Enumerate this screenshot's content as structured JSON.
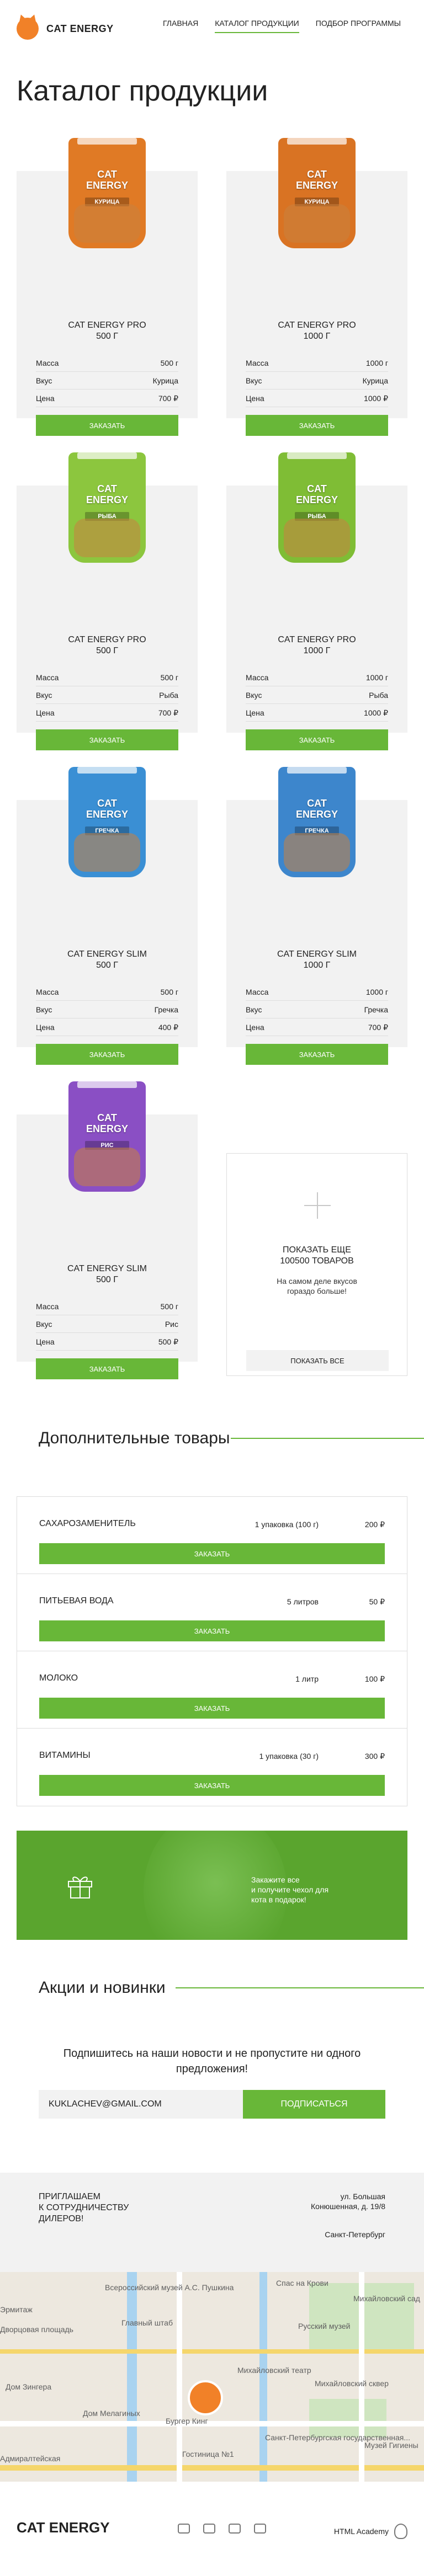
{
  "header": {
    "brand": "CAT ENERGY",
    "nav": [
      {
        "label": "Главная",
        "active": false
      },
      {
        "label": "Каталог продукции",
        "active": true
      },
      {
        "label": "Подбор программы",
        "active": false
      }
    ]
  },
  "page_title": "Каталог продукции",
  "product_labels": {
    "mass": "Масса",
    "flavor": "Вкус",
    "price": "Цена",
    "order": "Заказать"
  },
  "products": [
    {
      "name": "CAT ENERGY PRO\n500 Г",
      "mass": "500 г",
      "flavor": "Курица",
      "price": "700 ₽",
      "pack_color": "#e07a25",
      "pack_text": "CAT ENERGY",
      "pack_flavor": "КУРИЦА"
    },
    {
      "name": "CAT ENERGY PRO\n1000 Г",
      "mass": "1000 г",
      "flavor": "Курица",
      "price": "1000 ₽",
      "pack_color": "#d97323",
      "pack_text": "CAT ENERGY",
      "pack_flavor": "КУРИЦА"
    },
    {
      "name": "CAT ENERGY PRO\n500 Г",
      "mass": "500 г",
      "flavor": "Рыба",
      "price": "700 ₽",
      "pack_color": "#8cc63e",
      "pack_text": "CAT ENERGY",
      "pack_flavor": "РЫБА"
    },
    {
      "name": "CAT ENERGY PRO\n1000 Г",
      "mass": "1000 г",
      "flavor": "Рыба",
      "price": "1000 ₽",
      "pack_color": "#7fbd35",
      "pack_text": "CAT ENERGY",
      "pack_flavor": "РЫБА"
    },
    {
      "name": "CAT ENERGY SLIM\n500 Г",
      "mass": "500 г",
      "flavor": "Гречка",
      "price": "400 ₽",
      "pack_color": "#3a8fd4",
      "pack_text": "CAT ENERGY",
      "pack_flavor": "ГРЕЧКА"
    },
    {
      "name": "CAT ENERGY SLIM\n1000 Г",
      "mass": "1000 г",
      "flavor": "Гречка",
      "price": "700 ₽",
      "pack_color": "#3d86cc",
      "pack_text": "CAT ENERGY",
      "pack_flavor": "ГРЕЧКА"
    },
    {
      "name": "CAT ENERGY SLIM\n500 Г",
      "mass": "500 г",
      "flavor": "Рис",
      "price": "500 ₽",
      "pack_color": "#8a4fc4",
      "pack_text": "CAT ENERGY",
      "pack_flavor": "РИС"
    }
  ],
  "more_card": {
    "title": "Показать еще\n100500 товаров",
    "subtitle": "На самом деле вкусов\nгораздо больше!",
    "button": "Показать все"
  },
  "extras_section": {
    "title": "Дополнительные товары",
    "items": [
      {
        "name": "Сахарозаменитель",
        "qty": "1 упаковка (100 г)",
        "price": "200 ₽",
        "button": "Заказать"
      },
      {
        "name": "Питьевая вода",
        "qty": "5 литров",
        "price": "50 ₽",
        "button": "Заказать"
      },
      {
        "name": "Молоко",
        "qty": "1 литр",
        "price": "100 ₽",
        "button": "Заказать"
      },
      {
        "name": "Витамины",
        "qty": "1 упаковка (30 г)",
        "price": "300 ₽",
        "button": "Заказать"
      }
    ]
  },
  "promo": {
    "text": "Закажите все\nи получите чехол для\nкота в подарок!"
  },
  "news": {
    "title": "Акции и новинки",
    "text": "Подпишитесь на наши новости и не пропустите ни одного\nпредложения!",
    "email_value": "KUKLACHEV@GMAIL.COM",
    "button": "Подписаться"
  },
  "contacts": {
    "title": "Приглашаем\nк сотрудничеству\nдилеров!",
    "address": "ул. Большая\nКонюшенная, д. 19/8",
    "city": "Санкт-Петербург"
  },
  "map_labels": [
    "Всероссийский музей А.С. Пушкина",
    "Спас на Крови",
    "Михайловский сад",
    "Дворцовая площадь",
    "Главный штаб",
    "Русский музей",
    "Михайловский театр",
    "Дом Зингера",
    "Михайловский сквер",
    "Бургер Кинг",
    "Санкт-Петербургская государственная...",
    "Музей Гигиены",
    "Адмиралтейская",
    "Гостиница №1",
    "Дом Мелагиных",
    "Эрмитаж"
  ],
  "footer": {
    "brand": "CAT ENERGY",
    "academy": "HTML Academy"
  },
  "colors": {
    "accent": "#68b738",
    "logo": "#f18128",
    "gray": "#f2f2f2"
  }
}
